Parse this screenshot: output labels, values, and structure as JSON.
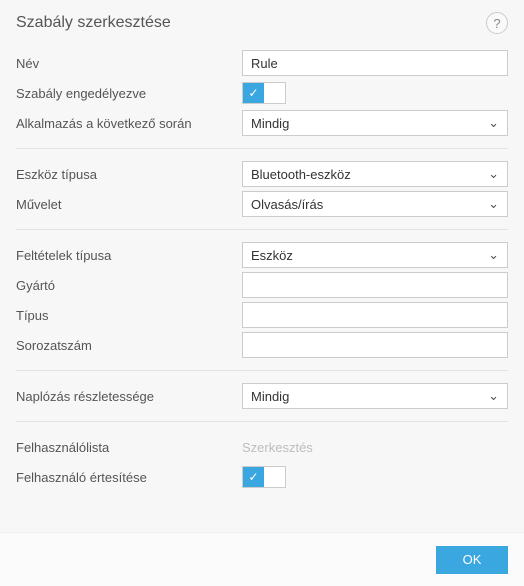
{
  "header": {
    "title": "Szabály szerkesztése",
    "help": "?"
  },
  "labels": {
    "name": "Név",
    "enabled": "Szabály engedélyezve",
    "apply_during": "Alkalmazás a következő során",
    "device_type": "Eszköz típusa",
    "action": "Művelet",
    "criteria_type": "Feltételek típusa",
    "vendor": "Gyártó",
    "model": "Típus",
    "serial": "Sorozatszám",
    "logging": "Naplózás részletessége",
    "userlist": "Felhasználólista",
    "notify": "Felhasználó értesítése"
  },
  "values": {
    "name": "Rule",
    "apply_during": "Mindig",
    "device_type": "Bluetooth-eszköz",
    "action": "Olvasás/írás",
    "criteria_type": "Eszköz",
    "vendor": "",
    "model": "",
    "serial": "",
    "logging": "Mindig",
    "userlist_action": "Szerkesztés"
  },
  "toggles": {
    "enabled": true,
    "notify": true
  },
  "footer": {
    "ok": "OK"
  },
  "icons": {
    "check": "✓",
    "chevron": "⌄"
  }
}
